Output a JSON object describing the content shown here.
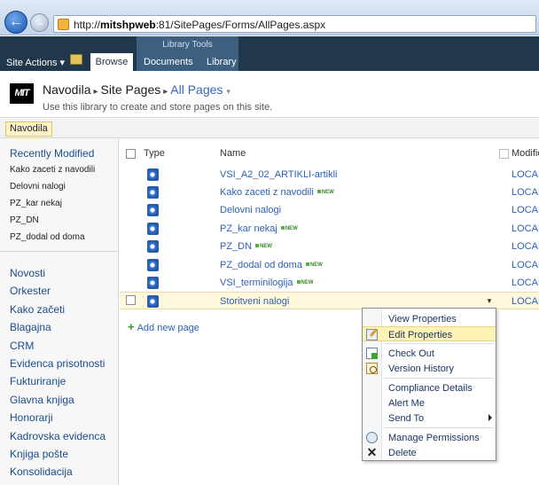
{
  "browser": {
    "url_prefix": "http://",
    "url_host": "mitshpweb",
    "url_path": ":81/SitePages/Forms/AllPages.aspx"
  },
  "ribbon": {
    "site_actions": "Site Actions ▾",
    "browse_tab": "Browse",
    "context_group": "Library Tools",
    "documents_tab": "Documents",
    "library_tab": "Library"
  },
  "title": {
    "logo": "MIT",
    "site": "Navodila",
    "library": "Site Pages",
    "view": "All Pages",
    "view_caret": "▾",
    "description": "Use this library to create and store pages on this site."
  },
  "crumb_chip": "Navodila",
  "left_nav": {
    "recent_title": "Recently Modified",
    "recent": [
      "Kako zaceti z navodili",
      "Delovni nalogi",
      "PZ_kar nekaj",
      "PZ_DN",
      "PZ_dodal od doma"
    ],
    "quick": [
      "Novosti",
      "Orkester",
      "Kako začeti",
      "Blagajna",
      "CRM",
      "Evidenca prisotnosti",
      "Fukturiranje",
      "Glavna knjiga",
      "Honorarji",
      "Kadrovska evidenca",
      "Knjiga pošte",
      "Konsolidacija"
    ]
  },
  "list": {
    "headers": {
      "type": "Type",
      "name": "Name",
      "modified": "Modifie"
    },
    "rows": [
      {
        "name": "VSI_A2_02_ARTIKLI-artikli",
        "new": "",
        "modified": "LOCAL"
      },
      {
        "name": "Kako zaceti z navodili",
        "new": "NEW",
        "modified": "LOCAL"
      },
      {
        "name": "Delovni nalogi",
        "new": "",
        "modified": "LOCAL"
      },
      {
        "name": "PZ_kar nekaj",
        "new": "NEW",
        "modified": "LOCAL"
      },
      {
        "name": "PZ_DN",
        "new": "NEW",
        "modified": "LOCAL"
      },
      {
        "name": "PZ_dodal od doma",
        "new": "NEW",
        "modified": "LOCAL"
      },
      {
        "name": "VSI_terminilogija",
        "new": "NEW",
        "modified": "LOCAL"
      },
      {
        "name": "Storitveni nalogi",
        "new": "",
        "modified": "LOCAL"
      }
    ],
    "add_page": "Add new page"
  },
  "context_menu": {
    "view_properties": "View Properties",
    "edit_properties": "Edit Properties",
    "check_out": "Check Out",
    "version_history": "Version History",
    "compliance_details": "Compliance Details",
    "alert_me": "Alert Me",
    "send_to": "Send To",
    "manage_permissions": "Manage Permissions",
    "delete": "Delete"
  },
  "icons": {
    "back": "back-arrow-icon",
    "forward": "forward-arrow-icon",
    "page": "ie-page-icon",
    "nav_up": "navigate-up-icon",
    "doc": "ie-document-icon",
    "add": "plus-icon",
    "dropdown": "chevron-down-icon",
    "delete": "x-icon"
  },
  "colors": {
    "ribbon": "#21374c",
    "context_tab": "#3d5f80",
    "link": "#2e61b3",
    "selected_row": "#fff8dc",
    "hover_item": "#fff2b5"
  }
}
